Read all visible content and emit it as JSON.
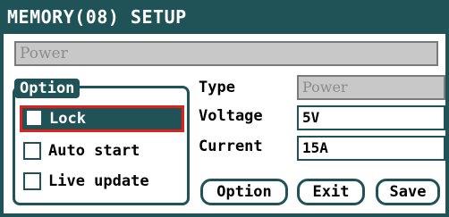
{
  "window": {
    "title": "MEMORY(08) SETUP"
  },
  "memory": {
    "name_value": "Power"
  },
  "option_group": {
    "legend": "Option",
    "items": [
      {
        "label": "Lock",
        "checked": false,
        "selected": true
      },
      {
        "label": "Auto start",
        "checked": false,
        "selected": false
      },
      {
        "label": "Live update",
        "checked": false,
        "selected": false
      }
    ]
  },
  "fields": {
    "type": {
      "label": "Type",
      "value": "Power",
      "disabled": true
    },
    "voltage": {
      "label": "Voltage",
      "value": "5V"
    },
    "current": {
      "label": "Current",
      "value": "15A"
    }
  },
  "buttons": {
    "option": "Option",
    "exit": "Exit",
    "save": "Save"
  },
  "colors": {
    "accent": "#1f5358",
    "focus_border": "#e0201a",
    "disabled_bg": "#c8c8c8",
    "disabled_text": "#8c8c8c"
  }
}
